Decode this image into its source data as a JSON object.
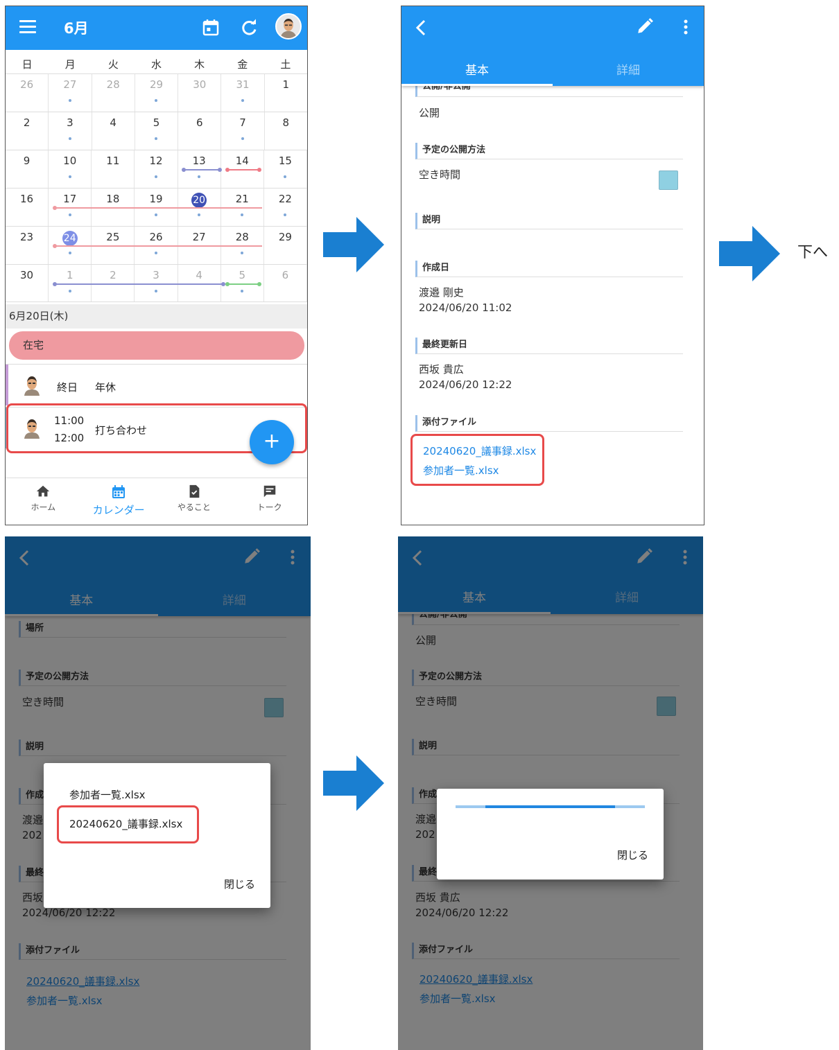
{
  "calendar": {
    "month_title": "6月",
    "weekdays": [
      "日",
      "月",
      "火",
      "水",
      "木",
      "金",
      "土"
    ],
    "weeks": [
      [
        "26",
        "27",
        "28",
        "29",
        "30",
        "31",
        "1"
      ],
      [
        "2",
        "3",
        "4",
        "5",
        "6",
        "7",
        "8"
      ],
      [
        "9",
        "10",
        "11",
        "12",
        "13",
        "14",
        "15"
      ],
      [
        "16",
        "17",
        "18",
        "19",
        "20",
        "21",
        "22"
      ],
      [
        "23",
        "24",
        "25",
        "26",
        "27",
        "28",
        "29"
      ],
      [
        "30",
        "1",
        "2",
        "3",
        "4",
        "5",
        "6"
      ]
    ],
    "selected_date": "6月20日(木)",
    "allday_event": "在宅",
    "events": [
      {
        "time": "終日",
        "title": "年休"
      },
      {
        "time_start": "11:00",
        "time_end": "12:00",
        "title": "打ち合わせ"
      }
    ],
    "fab_label": "+",
    "bottom_nav": [
      "ホーム",
      "カレンダー",
      "やること",
      "トーク"
    ],
    "colors": {
      "primary": "#2196f3",
      "pink_event": "#ef9aa0",
      "today": "#3f51b5",
      "highlight": "#e84a4a"
    }
  },
  "detail": {
    "tabs": [
      "基本",
      "詳細"
    ],
    "sections": {
      "visibility": "公開/非公開",
      "visibility_value": "公開",
      "publish_method": "予定の公開方法",
      "publish_method_value": "空き時間",
      "description": "説明",
      "location": "場所",
      "created": "作成日",
      "created_by": "渡邉 剛史",
      "created_at": "2024/06/20 11:02",
      "updated": "最終更新日",
      "updated_by": "西坂 貴広",
      "updated_at": "2024/06/20 12:22",
      "attachments": "添付ファイル"
    },
    "files": [
      "20240620_議事録.xlsx",
      "参加者一覧.xlsx"
    ],
    "partial": {
      "created_short": "作成",
      "created_by_short": "渡邉",
      "created_year_short": "202",
      "updated_short": "最終",
      "updated_by_short": "西坂"
    }
  },
  "file_dialog": {
    "items": [
      "参加者一覧.xlsx",
      "20240620_議事録.xlsx"
    ],
    "close": "閉じる"
  },
  "progress_dialog": {
    "close": "閉じる",
    "progress": 0.5
  },
  "flow": {
    "next_label": "下へ"
  }
}
